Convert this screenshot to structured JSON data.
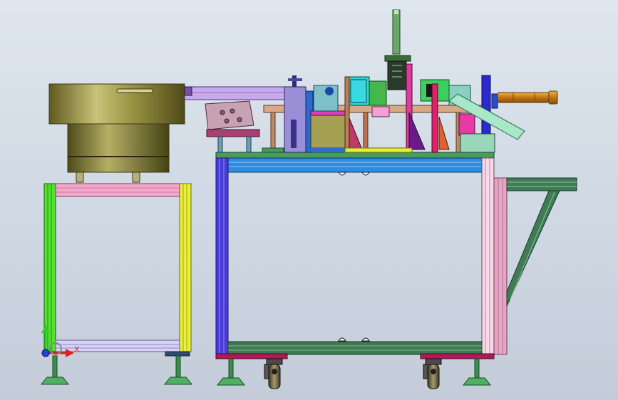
{
  "view_triad": {
    "x_label": "X",
    "y_label": "Y"
  },
  "colors": {
    "background": "#d3dce6",
    "frame_green": "#3d7a4e",
    "frame_blue": "#1f7fd1",
    "frame_purple": "#4b3bd6",
    "frame_pink": "#f3a9c6",
    "frame_lime": "#4fe02a",
    "frame_yellow": "#e8ef39",
    "bowl_olive": "#8f8a3a",
    "rail_lavender": "#c4a7e8",
    "cylinder_orange": "#d48a16"
  }
}
